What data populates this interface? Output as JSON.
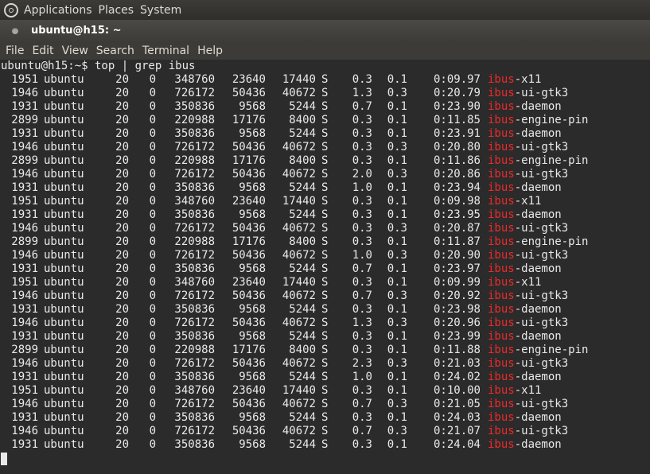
{
  "top_panel": {
    "menus": [
      "Applications",
      "Places",
      "System"
    ]
  },
  "window": {
    "title": "ubuntu@h15: ~"
  },
  "menubar": {
    "items": [
      "File",
      "Edit",
      "View",
      "Search",
      "Terminal",
      "Help"
    ]
  },
  "terminal": {
    "prompt_line": "ubuntu@h15:~$ top | grep ibus",
    "highlight_term": "ibus",
    "highlight_color": "#ef2929",
    "rows": [
      {
        "pid": "1951",
        "user": "ubuntu",
        "pr": "20",
        "ni": "0",
        "virt": "348760",
        "res": "23640",
        "shr": "17440",
        "s": "S",
        "cpu": "0.3",
        "mem": "0.1",
        "time": "0:09.97",
        "cmd_rest": "-x11"
      },
      {
        "pid": "1946",
        "user": "ubuntu",
        "pr": "20",
        "ni": "0",
        "virt": "726172",
        "res": "50436",
        "shr": "40672",
        "s": "S",
        "cpu": "1.3",
        "mem": "0.3",
        "time": "0:20.79",
        "cmd_rest": "-ui-gtk3"
      },
      {
        "pid": "1931",
        "user": "ubuntu",
        "pr": "20",
        "ni": "0",
        "virt": "350836",
        "res": "9568",
        "shr": "5244",
        "s": "S",
        "cpu": "0.7",
        "mem": "0.1",
        "time": "0:23.90",
        "cmd_rest": "-daemon"
      },
      {
        "pid": "2899",
        "user": "ubuntu",
        "pr": "20",
        "ni": "0",
        "virt": "220988",
        "res": "17176",
        "shr": "8400",
        "s": "S",
        "cpu": "0.3",
        "mem": "0.1",
        "time": "0:11.85",
        "cmd_rest": "-engine-pin"
      },
      {
        "pid": "1931",
        "user": "ubuntu",
        "pr": "20",
        "ni": "0",
        "virt": "350836",
        "res": "9568",
        "shr": "5244",
        "s": "S",
        "cpu": "0.3",
        "mem": "0.1",
        "time": "0:23.91",
        "cmd_rest": "-daemon"
      },
      {
        "pid": "1946",
        "user": "ubuntu",
        "pr": "20",
        "ni": "0",
        "virt": "726172",
        "res": "50436",
        "shr": "40672",
        "s": "S",
        "cpu": "0.3",
        "mem": "0.3",
        "time": "0:20.80",
        "cmd_rest": "-ui-gtk3"
      },
      {
        "pid": "2899",
        "user": "ubuntu",
        "pr": "20",
        "ni": "0",
        "virt": "220988",
        "res": "17176",
        "shr": "8400",
        "s": "S",
        "cpu": "0.3",
        "mem": "0.1",
        "time": "0:11.86",
        "cmd_rest": "-engine-pin"
      },
      {
        "pid": "1946",
        "user": "ubuntu",
        "pr": "20",
        "ni": "0",
        "virt": "726172",
        "res": "50436",
        "shr": "40672",
        "s": "S",
        "cpu": "2.0",
        "mem": "0.3",
        "time": "0:20.86",
        "cmd_rest": "-ui-gtk3"
      },
      {
        "pid": "1931",
        "user": "ubuntu",
        "pr": "20",
        "ni": "0",
        "virt": "350836",
        "res": "9568",
        "shr": "5244",
        "s": "S",
        "cpu": "1.0",
        "mem": "0.1",
        "time": "0:23.94",
        "cmd_rest": "-daemon"
      },
      {
        "pid": "1951",
        "user": "ubuntu",
        "pr": "20",
        "ni": "0",
        "virt": "348760",
        "res": "23640",
        "shr": "17440",
        "s": "S",
        "cpu": "0.3",
        "mem": "0.1",
        "time": "0:09.98",
        "cmd_rest": "-x11"
      },
      {
        "pid": "1931",
        "user": "ubuntu",
        "pr": "20",
        "ni": "0",
        "virt": "350836",
        "res": "9568",
        "shr": "5244",
        "s": "S",
        "cpu": "0.3",
        "mem": "0.1",
        "time": "0:23.95",
        "cmd_rest": "-daemon"
      },
      {
        "pid": "1946",
        "user": "ubuntu",
        "pr": "20",
        "ni": "0",
        "virt": "726172",
        "res": "50436",
        "shr": "40672",
        "s": "S",
        "cpu": "0.3",
        "mem": "0.3",
        "time": "0:20.87",
        "cmd_rest": "-ui-gtk3"
      },
      {
        "pid": "2899",
        "user": "ubuntu",
        "pr": "20",
        "ni": "0",
        "virt": "220988",
        "res": "17176",
        "shr": "8400",
        "s": "S",
        "cpu": "0.3",
        "mem": "0.1",
        "time": "0:11.87",
        "cmd_rest": "-engine-pin"
      },
      {
        "pid": "1946",
        "user": "ubuntu",
        "pr": "20",
        "ni": "0",
        "virt": "726172",
        "res": "50436",
        "shr": "40672",
        "s": "S",
        "cpu": "1.0",
        "mem": "0.3",
        "time": "0:20.90",
        "cmd_rest": "-ui-gtk3"
      },
      {
        "pid": "1931",
        "user": "ubuntu",
        "pr": "20",
        "ni": "0",
        "virt": "350836",
        "res": "9568",
        "shr": "5244",
        "s": "S",
        "cpu": "0.7",
        "mem": "0.1",
        "time": "0:23.97",
        "cmd_rest": "-daemon"
      },
      {
        "pid": "1951",
        "user": "ubuntu",
        "pr": "20",
        "ni": "0",
        "virt": "348760",
        "res": "23640",
        "shr": "17440",
        "s": "S",
        "cpu": "0.3",
        "mem": "0.1",
        "time": "0:09.99",
        "cmd_rest": "-x11"
      },
      {
        "pid": "1946",
        "user": "ubuntu",
        "pr": "20",
        "ni": "0",
        "virt": "726172",
        "res": "50436",
        "shr": "40672",
        "s": "S",
        "cpu": "0.7",
        "mem": "0.3",
        "time": "0:20.92",
        "cmd_rest": "-ui-gtk3"
      },
      {
        "pid": "1931",
        "user": "ubuntu",
        "pr": "20",
        "ni": "0",
        "virt": "350836",
        "res": "9568",
        "shr": "5244",
        "s": "S",
        "cpu": "0.3",
        "mem": "0.1",
        "time": "0:23.98",
        "cmd_rest": "-daemon"
      },
      {
        "pid": "1946",
        "user": "ubuntu",
        "pr": "20",
        "ni": "0",
        "virt": "726172",
        "res": "50436",
        "shr": "40672",
        "s": "S",
        "cpu": "1.3",
        "mem": "0.3",
        "time": "0:20.96",
        "cmd_rest": "-ui-gtk3"
      },
      {
        "pid": "1931",
        "user": "ubuntu",
        "pr": "20",
        "ni": "0",
        "virt": "350836",
        "res": "9568",
        "shr": "5244",
        "s": "S",
        "cpu": "0.3",
        "mem": "0.1",
        "time": "0:23.99",
        "cmd_rest": "-daemon"
      },
      {
        "pid": "2899",
        "user": "ubuntu",
        "pr": "20",
        "ni": "0",
        "virt": "220988",
        "res": "17176",
        "shr": "8400",
        "s": "S",
        "cpu": "0.3",
        "mem": "0.1",
        "time": "0:11.88",
        "cmd_rest": "-engine-pin"
      },
      {
        "pid": "1946",
        "user": "ubuntu",
        "pr": "20",
        "ni": "0",
        "virt": "726172",
        "res": "50436",
        "shr": "40672",
        "s": "S",
        "cpu": "2.3",
        "mem": "0.3",
        "time": "0:21.03",
        "cmd_rest": "-ui-gtk3"
      },
      {
        "pid": "1931",
        "user": "ubuntu",
        "pr": "20",
        "ni": "0",
        "virt": "350836",
        "res": "9568",
        "shr": "5244",
        "s": "S",
        "cpu": "1.0",
        "mem": "0.1",
        "time": "0:24.02",
        "cmd_rest": "-daemon"
      },
      {
        "pid": "1951",
        "user": "ubuntu",
        "pr": "20",
        "ni": "0",
        "virt": "348760",
        "res": "23640",
        "shr": "17440",
        "s": "S",
        "cpu": "0.3",
        "mem": "0.1",
        "time": "0:10.00",
        "cmd_rest": "-x11"
      },
      {
        "pid": "1946",
        "user": "ubuntu",
        "pr": "20",
        "ni": "0",
        "virt": "726172",
        "res": "50436",
        "shr": "40672",
        "s": "S",
        "cpu": "0.7",
        "mem": "0.3",
        "time": "0:21.05",
        "cmd_rest": "-ui-gtk3"
      },
      {
        "pid": "1931",
        "user": "ubuntu",
        "pr": "20",
        "ni": "0",
        "virt": "350836",
        "res": "9568",
        "shr": "5244",
        "s": "S",
        "cpu": "0.3",
        "mem": "0.1",
        "time": "0:24.03",
        "cmd_rest": "-daemon"
      },
      {
        "pid": "1946",
        "user": "ubuntu",
        "pr": "20",
        "ni": "0",
        "virt": "726172",
        "res": "50436",
        "shr": "40672",
        "s": "S",
        "cpu": "0.7",
        "mem": "0.3",
        "time": "0:21.07",
        "cmd_rest": "-ui-gtk3"
      },
      {
        "pid": "1931",
        "user": "ubuntu",
        "pr": "20",
        "ni": "0",
        "virt": "350836",
        "res": "9568",
        "shr": "5244",
        "s": "S",
        "cpu": "0.3",
        "mem": "0.1",
        "time": "0:24.04",
        "cmd_rest": "-daemon"
      }
    ]
  }
}
